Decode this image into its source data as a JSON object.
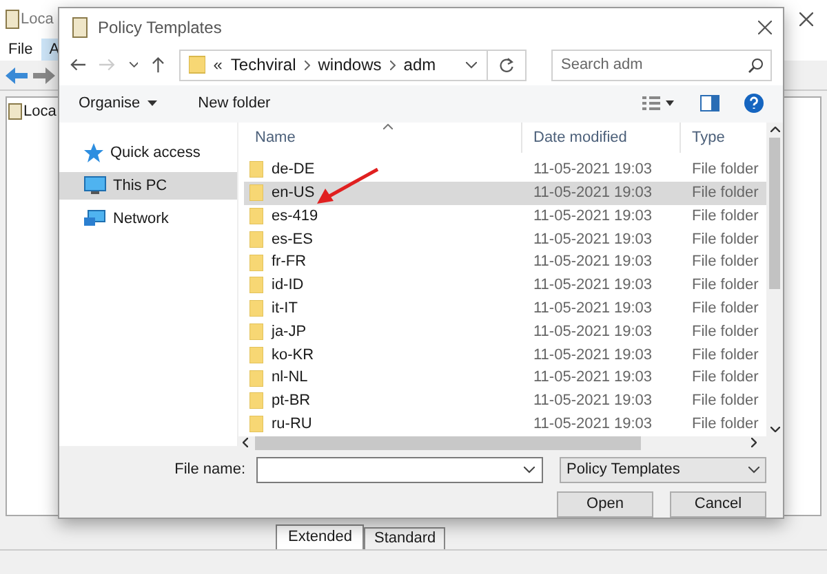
{
  "background_window": {
    "title": "Loca",
    "menu": [
      {
        "label": "File",
        "selected": false
      },
      {
        "label": "A",
        "selected": true
      }
    ],
    "tree_root": "Loca",
    "tabs": [
      {
        "label": "Extended",
        "selected": true
      },
      {
        "label": "Standard",
        "selected": false
      }
    ]
  },
  "dialog": {
    "title": "Policy Templates",
    "breadcrumb": [
      "«",
      "Techviral",
      "windows",
      "adm"
    ],
    "search": {
      "placeholder": "Search adm"
    },
    "toolbar": [
      "Organise",
      "New folder"
    ],
    "nav": [
      {
        "kind": "star",
        "label": "Quick access",
        "selected": false
      },
      {
        "kind": "pc",
        "label": "This PC",
        "selected": true
      },
      {
        "kind": "network",
        "label": "Network",
        "selected": false
      }
    ],
    "columns": [
      "Name",
      "Date modified",
      "Type"
    ],
    "rows": [
      {
        "name": "de-DE",
        "date": "11-05-2021 19:03",
        "type": "File folder",
        "selected": false
      },
      {
        "name": "en-US",
        "date": "11-05-2021 19:03",
        "type": "File folder",
        "selected": true
      },
      {
        "name": "es-419",
        "date": "11-05-2021 19:03",
        "type": "File folder",
        "selected": false
      },
      {
        "name": "es-ES",
        "date": "11-05-2021 19:03",
        "type": "File folder",
        "selected": false
      },
      {
        "name": "fr-FR",
        "date": "11-05-2021 19:03",
        "type": "File folder",
        "selected": false
      },
      {
        "name": "id-ID",
        "date": "11-05-2021 19:03",
        "type": "File folder",
        "selected": false
      },
      {
        "name": "it-IT",
        "date": "11-05-2021 19:03",
        "type": "File folder",
        "selected": false
      },
      {
        "name": "ja-JP",
        "date": "11-05-2021 19:03",
        "type": "File folder",
        "selected": false
      },
      {
        "name": "ko-KR",
        "date": "11-05-2021 19:03",
        "type": "File folder",
        "selected": false
      },
      {
        "name": "nl-NL",
        "date": "11-05-2021 19:03",
        "type": "File folder",
        "selected": false
      },
      {
        "name": "pt-BR",
        "date": "11-05-2021 19:03",
        "type": "File folder",
        "selected": false
      },
      {
        "name": "ru-RU",
        "date": "11-05-2021 19:03",
        "type": "File folder",
        "selected": false
      }
    ],
    "file_name_label": "File name:",
    "file_type": "Policy Templates",
    "buttons": [
      "Open",
      "Cancel"
    ]
  }
}
